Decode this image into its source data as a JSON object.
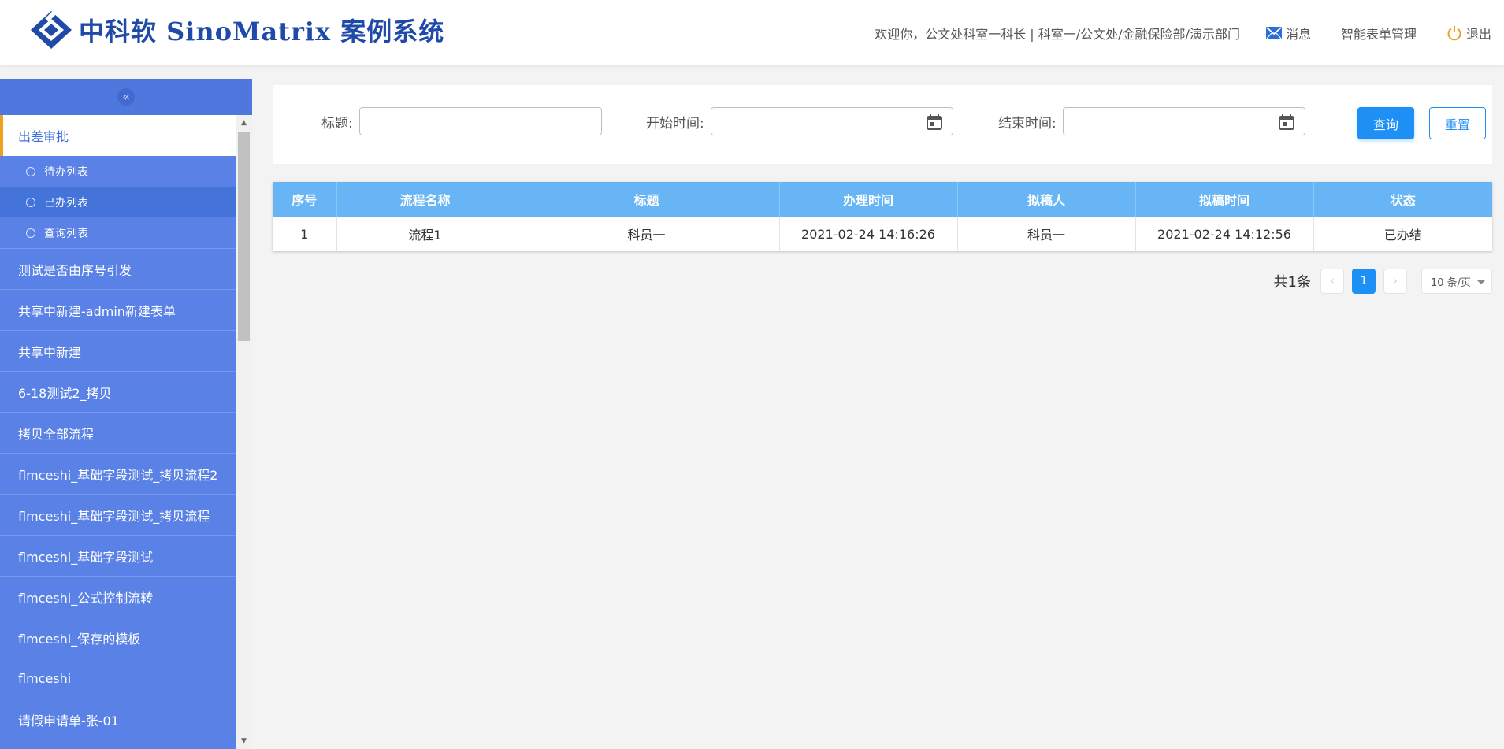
{
  "header": {
    "logo_cn": "中科软",
    "logo_en": "SinoMatrix",
    "logo_suffix": "案例系统",
    "welcome": "欢迎你，公文处科室一科长 | 科室一/公文处/金融保险部/演示部门",
    "messages_label": "消息",
    "form_admin_label": "智能表单管理",
    "logout_label": "退出",
    "icons": {
      "messages": "envelope-icon",
      "logout": "power-icon"
    },
    "colors": {
      "brand": "#1f4aa8",
      "logout_icon": "#f0a020"
    }
  },
  "sidebar": {
    "collapse_icon": "double-chevron-left-icon",
    "active_group": "出差审批",
    "sub_items": [
      {
        "label": "待办列表"
      },
      {
        "label": "已办列表"
      },
      {
        "label": "查询列表"
      }
    ],
    "items": [
      {
        "label": "测试是否由序号引发"
      },
      {
        "label": "共享中新建-admin新建表单"
      },
      {
        "label": "共享中新建"
      },
      {
        "label": "6-18测试2_拷贝"
      },
      {
        "label": "拷贝全部流程"
      },
      {
        "label": "flmceshi_基础字段测试_拷贝流程2"
      },
      {
        "label": "flmceshi_基础字段测试_拷贝流程"
      },
      {
        "label": "flmceshi_基础字段测试"
      },
      {
        "label": "flmceshi_公式控制流转"
      },
      {
        "label": "flmceshi_保存的模板"
      },
      {
        "label": "flmceshi"
      },
      {
        "label": "请假申请单-张-01"
      }
    ],
    "colors": {
      "background": "#5a82e6",
      "active_sub": "#4474d9",
      "active_marker": "#f0a020"
    }
  },
  "search": {
    "title_label": "标题:",
    "title_value": "",
    "start_label": "开始时间:",
    "start_value": "",
    "end_label": "结束时间:",
    "end_value": "",
    "query_label": "查询",
    "reset_label": "重置",
    "calendar_icon": "calendar-icon"
  },
  "table": {
    "columns": [
      "序号",
      "流程名称",
      "标题",
      "办理时间",
      "拟稿人",
      "拟稿时间",
      "状态"
    ],
    "rows": [
      [
        "1",
        "流程1",
        "科员一",
        "2021-02-24 14:16:26",
        "科员一",
        "2021-02-24 14:12:56",
        "已办结"
      ]
    ],
    "header_color": "#67b5f5"
  },
  "pagination": {
    "total": "共1条",
    "prev": "‹",
    "current": "1",
    "next": "›",
    "page_size": "10 条/页"
  }
}
